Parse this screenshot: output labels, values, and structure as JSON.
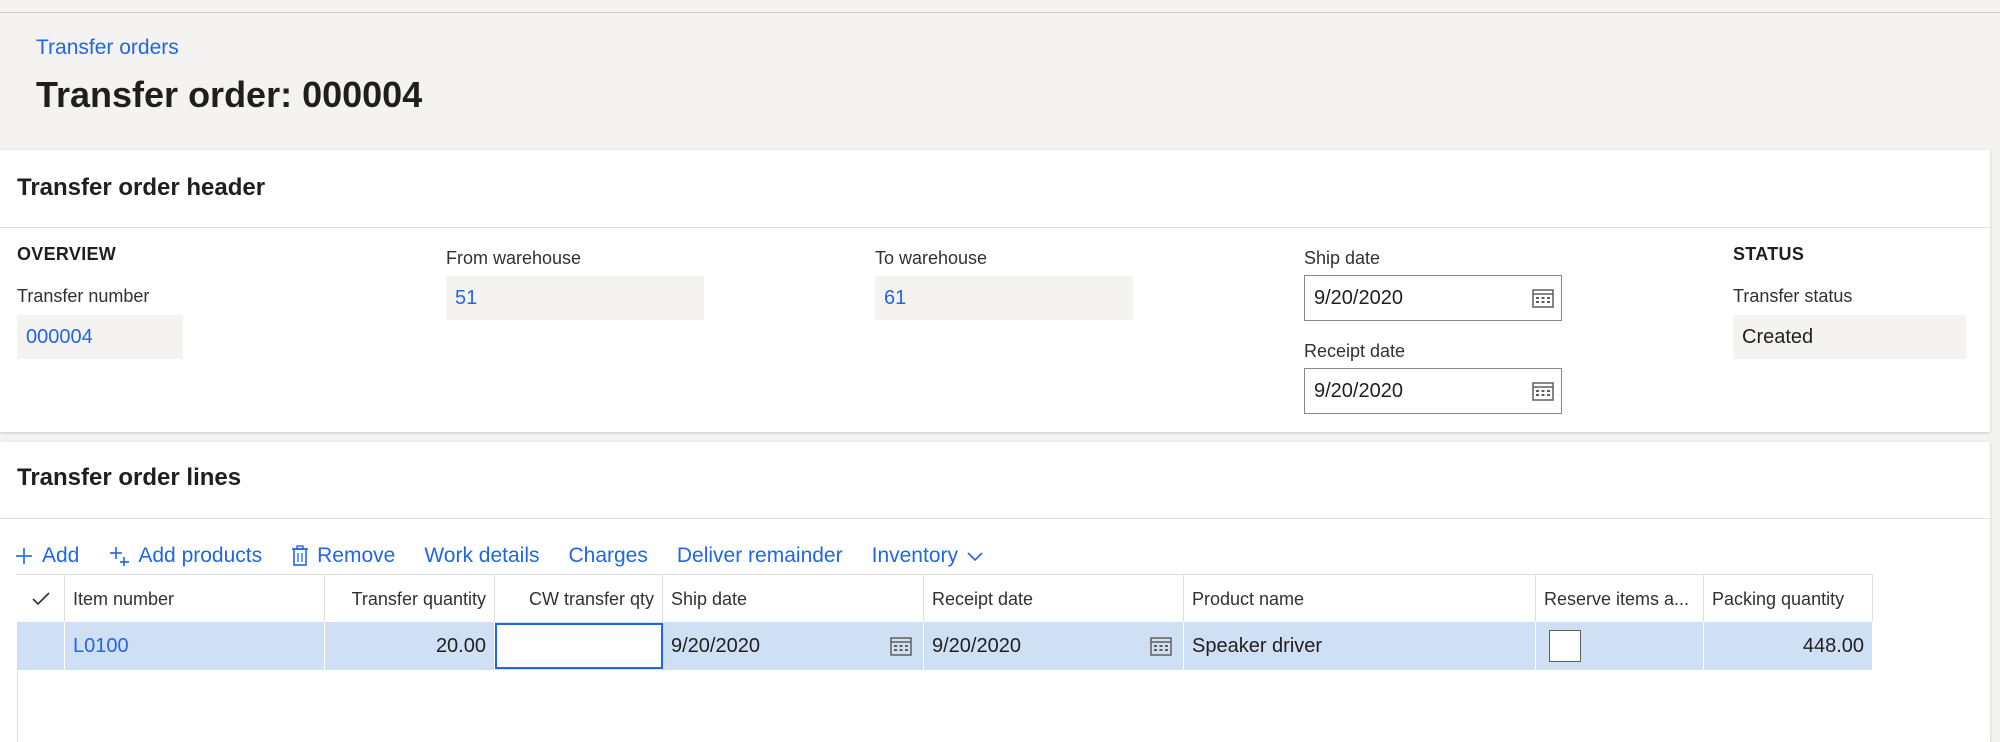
{
  "breadcrumb": "Transfer orders",
  "page_title": "Transfer order: 000004",
  "header_section": {
    "title": "Transfer order header",
    "overview_label": "OVERVIEW",
    "transfer_number_label": "Transfer number",
    "transfer_number_value": "000004",
    "from_warehouse_label": "From warehouse",
    "from_warehouse_value": "51",
    "to_warehouse_label": "To warehouse",
    "to_warehouse_value": "61",
    "ship_date_label": "Ship date",
    "ship_date_value": "9/20/2020",
    "receipt_date_label": "Receipt date",
    "receipt_date_value": "9/20/2020",
    "status_label": "STATUS",
    "transfer_status_label": "Transfer status",
    "transfer_status_value": "Created"
  },
  "lines_section": {
    "title": "Transfer order lines",
    "toolbar": {
      "add": "Add",
      "add_products": "Add products",
      "remove": "Remove",
      "work_details": "Work details",
      "charges": "Charges",
      "deliver_remainder": "Deliver remainder",
      "inventory": "Inventory"
    },
    "columns": {
      "item_number": "Item number",
      "transfer_quantity": "Transfer quantity",
      "cw_transfer_qty": "CW transfer qty",
      "ship_date": "Ship date",
      "receipt_date": "Receipt date",
      "product_name": "Product name",
      "reserve_items": "Reserve items a...",
      "packing_quantity": "Packing quantity"
    },
    "rows": [
      {
        "item_number": "L0100",
        "transfer_quantity": "20.00",
        "cw_transfer_qty": "",
        "ship_date": "9/20/2020",
        "receipt_date": "9/20/2020",
        "product_name": "Speaker driver",
        "packing_quantity": "448.00"
      }
    ]
  },
  "icons": {
    "calendar": "calendar-icon",
    "add": "plus-icon",
    "add_products": "add-products-icon",
    "remove": "trash-icon",
    "inventory_dropdown": "chevron-down-icon",
    "select_all": "checkmark-icon"
  },
  "colors": {
    "accent": "#2266e3",
    "selected_row": "#cfe0f5",
    "page_background": "#f4f3f2"
  }
}
